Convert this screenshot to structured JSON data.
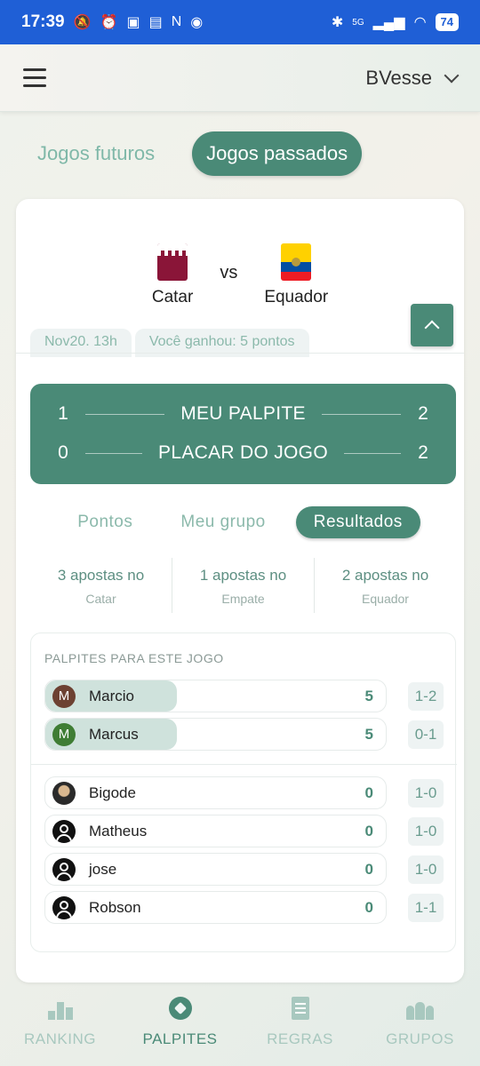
{
  "status_bar": {
    "time": "17:39",
    "network": "5G",
    "battery": "74"
  },
  "header": {
    "user_name": "BVesse"
  },
  "top_tabs": [
    {
      "label": "Jogos futuros",
      "active": false
    },
    {
      "label": "Jogos passados",
      "active": true
    }
  ],
  "match": {
    "home_team": "Catar",
    "vs_label": "vs",
    "away_team": "Equador",
    "date": "Nov20. 13h",
    "result_text": "Você ganhou: 5 pontos"
  },
  "score": {
    "my_guess_label": "MEU PALPITE",
    "my_guess_home": "1",
    "my_guess_away": "2",
    "final_label": "PLACAR DO JOGO",
    "final_home": "0",
    "final_away": "2"
  },
  "sub_tabs": [
    {
      "label": "Pontos",
      "active": false
    },
    {
      "label": "Meu grupo",
      "active": false
    },
    {
      "label": "Resultados",
      "active": true
    }
  ],
  "stats": [
    {
      "top": "3 apostas no",
      "bottom": "Catar"
    },
    {
      "top": "1 apostas no",
      "bottom": "Empate"
    },
    {
      "top": "2 apostas no",
      "bottom": "Equador"
    }
  ],
  "predictions": {
    "title": "PALPITES PARA ESTE JOGO",
    "rows": [
      {
        "initial": "M",
        "name": "Marcio",
        "points": "5",
        "score": "1-2",
        "avatar": "brown"
      },
      {
        "initial": "M",
        "name": "Marcus",
        "points": "5",
        "score": "0-1",
        "avatar": "green"
      },
      {
        "initial": "",
        "name": "Bigode",
        "points": "0",
        "score": "1-0",
        "avatar": "photo"
      },
      {
        "initial": "",
        "name": "Matheus",
        "points": "0",
        "score": "1-0",
        "avatar": "generic"
      },
      {
        "initial": "",
        "name": "jose",
        "points": "0",
        "score": "1-0",
        "avatar": "generic"
      },
      {
        "initial": "",
        "name": "Robson",
        "points": "0",
        "score": "1-1",
        "avatar": "generic"
      }
    ]
  },
  "bottom_nav": [
    {
      "label": "RANKING",
      "icon": "podium-icon",
      "active": false
    },
    {
      "label": "PALPITES",
      "icon": "soccer-ball-icon",
      "active": true
    },
    {
      "label": "REGRAS",
      "icon": "document-icon",
      "active": false
    },
    {
      "label": "GRUPOS",
      "icon": "group-icon",
      "active": false
    }
  ],
  "colors": {
    "status_bar": "#1f5fd6",
    "accent": "#4a8a77",
    "muted": "#8bb9ab"
  }
}
